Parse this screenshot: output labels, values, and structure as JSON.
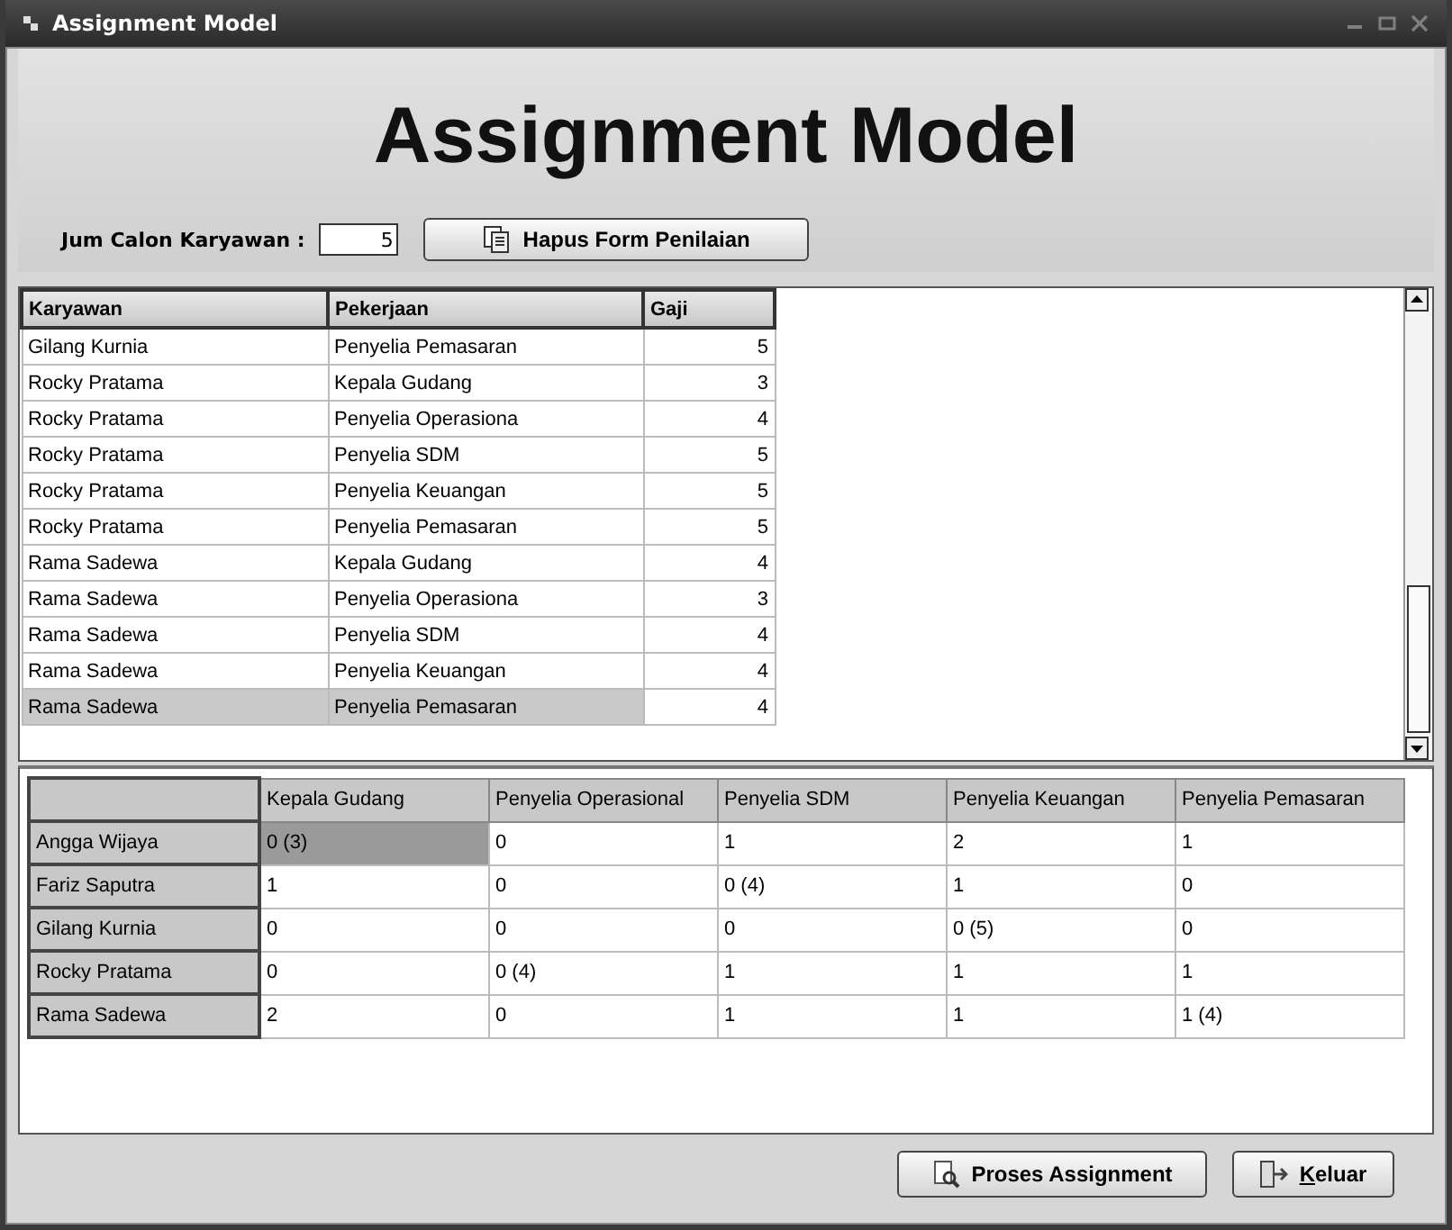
{
  "window": {
    "title": "Assignment Model"
  },
  "heading": "Assignment Model",
  "candidates": {
    "label": "Jum Calon Karyawan :",
    "value": "5"
  },
  "clear_button": {
    "label": "Hapus Form Penilaian"
  },
  "salary_table": {
    "columns": [
      "Karyawan",
      "Pekerjaan",
      "Gaji"
    ],
    "rows": [
      {
        "cells": [
          "Gilang Kurnia",
          "Penyelia Pemasaran",
          "5"
        ],
        "selected": false
      },
      {
        "cells": [
          "Rocky Pratama",
          "Kepala Gudang",
          "3"
        ],
        "selected": false
      },
      {
        "cells": [
          "Rocky Pratama",
          "Penyelia Operasiona",
          "4"
        ],
        "selected": false
      },
      {
        "cells": [
          "Rocky Pratama",
          "Penyelia SDM",
          "5"
        ],
        "selected": false
      },
      {
        "cells": [
          "Rocky Pratama",
          "Penyelia Keuangan",
          "5"
        ],
        "selected": false
      },
      {
        "cells": [
          "Rocky Pratama",
          "Penyelia Pemasaran",
          "5"
        ],
        "selected": false
      },
      {
        "cells": [
          "Rama Sadewa",
          "Kepala Gudang",
          "4"
        ],
        "selected": false
      },
      {
        "cells": [
          "Rama Sadewa",
          "Penyelia Operasiona",
          "3"
        ],
        "selected": false
      },
      {
        "cells": [
          "Rama Sadewa",
          "Penyelia SDM",
          "4"
        ],
        "selected": false
      },
      {
        "cells": [
          "Rama Sadewa",
          "Penyelia Keuangan",
          "4"
        ],
        "selected": false
      },
      {
        "cells": [
          "Rama Sadewa",
          "Penyelia Pemasaran",
          "4"
        ],
        "selected": true
      }
    ]
  },
  "matrix": {
    "columns": [
      "Kepala Gudang",
      "Penyelia Operasional",
      "Penyelia SDM",
      "Penyelia Keuangan",
      "Penyelia Pemasaran"
    ],
    "rows": [
      {
        "name": "Angga Wijaya",
        "cells": [
          {
            "text": "0 (3)",
            "selected": true
          },
          {
            "text": "0",
            "selected": false
          },
          {
            "text": "1",
            "selected": false
          },
          {
            "text": "2",
            "selected": false
          },
          {
            "text": "1",
            "selected": false
          }
        ]
      },
      {
        "name": "Fariz Saputra",
        "cells": [
          {
            "text": "1",
            "selected": false
          },
          {
            "text": "0",
            "selected": false
          },
          {
            "text": "0 (4)",
            "selected": false
          },
          {
            "text": "1",
            "selected": false
          },
          {
            "text": "0",
            "selected": false
          }
        ]
      },
      {
        "name": "Gilang Kurnia",
        "cells": [
          {
            "text": "0",
            "selected": false
          },
          {
            "text": "0",
            "selected": false
          },
          {
            "text": "0",
            "selected": false
          },
          {
            "text": "0 (5)",
            "selected": false
          },
          {
            "text": "0",
            "selected": false
          }
        ]
      },
      {
        "name": "Rocky Pratama",
        "cells": [
          {
            "text": "0",
            "selected": false
          },
          {
            "text": "0 (4)",
            "selected": false
          },
          {
            "text": "1",
            "selected": false
          },
          {
            "text": "1",
            "selected": false
          },
          {
            "text": "1",
            "selected": false
          }
        ]
      },
      {
        "name": "Rama Sadewa",
        "cells": [
          {
            "text": "2",
            "selected": false
          },
          {
            "text": "0",
            "selected": false
          },
          {
            "text": "1",
            "selected": false
          },
          {
            "text": "1",
            "selected": false
          },
          {
            "text": "1 (4)",
            "selected": false
          }
        ]
      }
    ]
  },
  "buttons": [
    {
      "label": "Proses Assignment",
      "kind": "process",
      "mnemonic": false
    },
    {
      "label": "Keluar",
      "kind": "exit",
      "mnemonic": true
    }
  ]
}
